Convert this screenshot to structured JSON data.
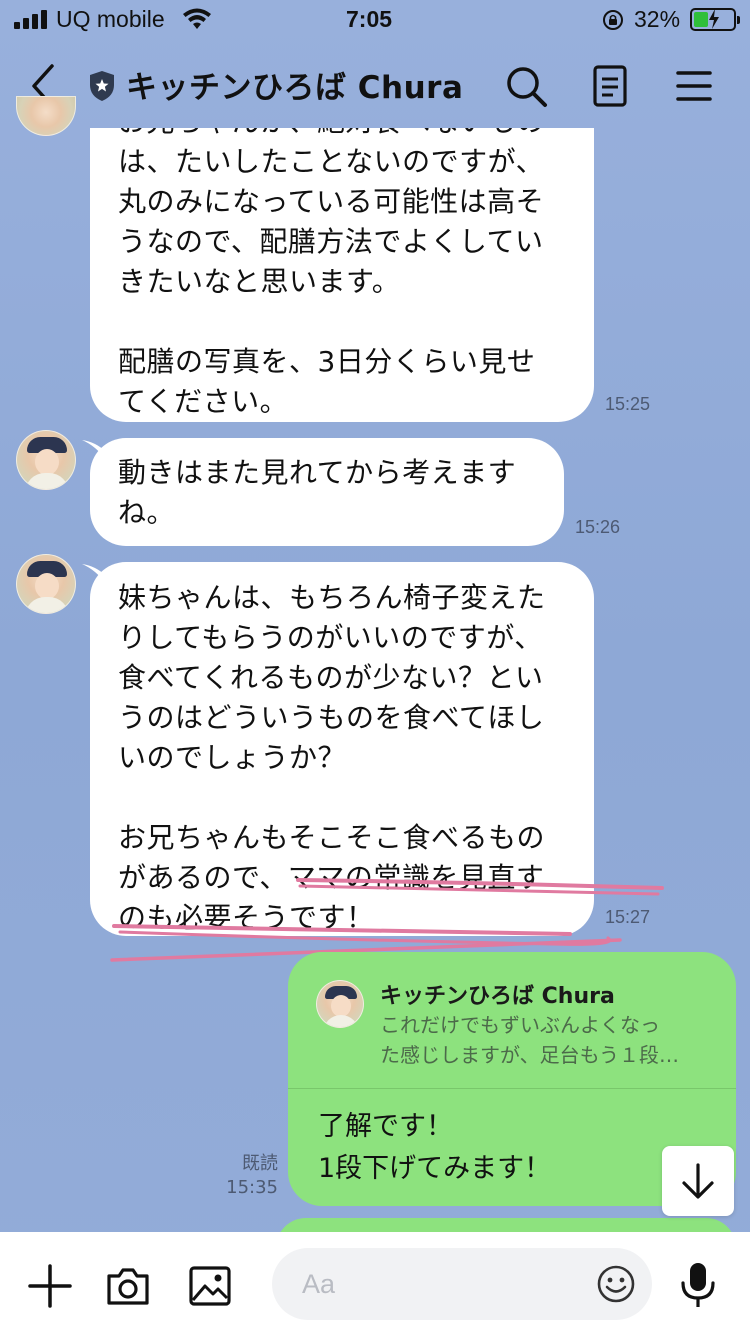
{
  "status_bar": {
    "carrier": "UQ mobile",
    "time": "7:05",
    "battery": "32%",
    "battery_level": 0.32
  },
  "header": {
    "title": "キッチンひろば Chura",
    "icons": [
      "back-icon",
      "shield-icon",
      "search-icon",
      "notes-icon",
      "menu-icon"
    ]
  },
  "messages": [
    {
      "side": "left",
      "text": "お兄ちゃんが、絶対食べないもの\nは、たいしたことないのですが、\n丸のみになっている可能性は高そ\nうなので、配膳方法でよくしてい\nきたいなと思います。\n\n配膳の写真を、3日分くらい見せ\nてください。",
      "time": "15:25"
    },
    {
      "side": "left",
      "text": "動きはまた見れてから考えます\nね。",
      "time": "15:26"
    },
    {
      "side": "left",
      "text": "妹ちゃんは、もちろん椅子変えた\nりしてもらうのがいいのですが、\n食べてくれるものが少ない？とい\nうのはどういうものを食べてほし\nいのでしょうか？\n\nお兄ちゃんもそこそこ食べるもの\nがあるので、ママの常識を見直す\nのも必要そうです！",
      "time": "15:27"
    },
    {
      "side": "right",
      "reply_to": {
        "name": "キッチンひろば Chura",
        "snippet": "これだけでもずいぶんよくなっ\nた感じしますが、足台もう１段…"
      },
      "text": "了解です！\n1段下げてみます！",
      "read": "既読",
      "time": "15:35"
    }
  ],
  "colors": {
    "background": "#8fa9d6",
    "sent_bubble": "#8de27e",
    "received_bubble": "#ffffff",
    "highlight_scribble": "#e07aa0"
  },
  "input": {
    "placeholder": "Aa"
  },
  "input_icons": [
    "plus-icon",
    "camera-icon",
    "image-icon",
    "emoji-icon",
    "mic-icon"
  ]
}
